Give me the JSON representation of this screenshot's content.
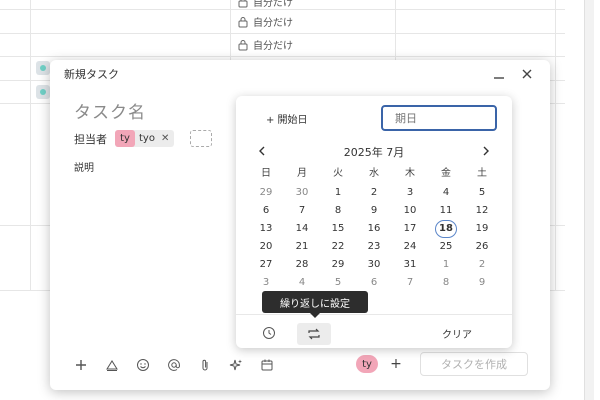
{
  "background": {
    "privacy_label": "自分だけ",
    "privacy_icon": "lock-icon"
  },
  "modal": {
    "title": "新規タスク",
    "task_name_placeholder": "タスク名",
    "assignee_label": "担当者",
    "assignee": {
      "initials": "ty",
      "name": "tyo"
    },
    "description_label": "説明",
    "owner_initials": "ty",
    "create_button": "タスクを作成"
  },
  "picker": {
    "start_date_label": "+ 開始日",
    "due_placeholder": "期日",
    "month_label": "2025年 7月",
    "weekdays": [
      "日",
      "月",
      "火",
      "水",
      "木",
      "金",
      "土"
    ],
    "weeks": [
      [
        "29",
        "30",
        "1",
        "2",
        "3",
        "4",
        "5"
      ],
      [
        "6",
        "7",
        "8",
        "9",
        "10",
        "11",
        "12"
      ],
      [
        "13",
        "14",
        "15",
        "16",
        "17",
        "18",
        "19"
      ],
      [
        "20",
        "21",
        "22",
        "23",
        "24",
        "25",
        "26"
      ],
      [
        "27",
        "28",
        "29",
        "30",
        "31",
        "1",
        "2"
      ],
      [
        "3",
        "4",
        "5",
        "6",
        "7",
        "8",
        "9"
      ]
    ],
    "today": "18",
    "clear_label": "クリア",
    "repeat_tooltip": "繰り返しに設定",
    "accent_color": "#3a64a8"
  }
}
